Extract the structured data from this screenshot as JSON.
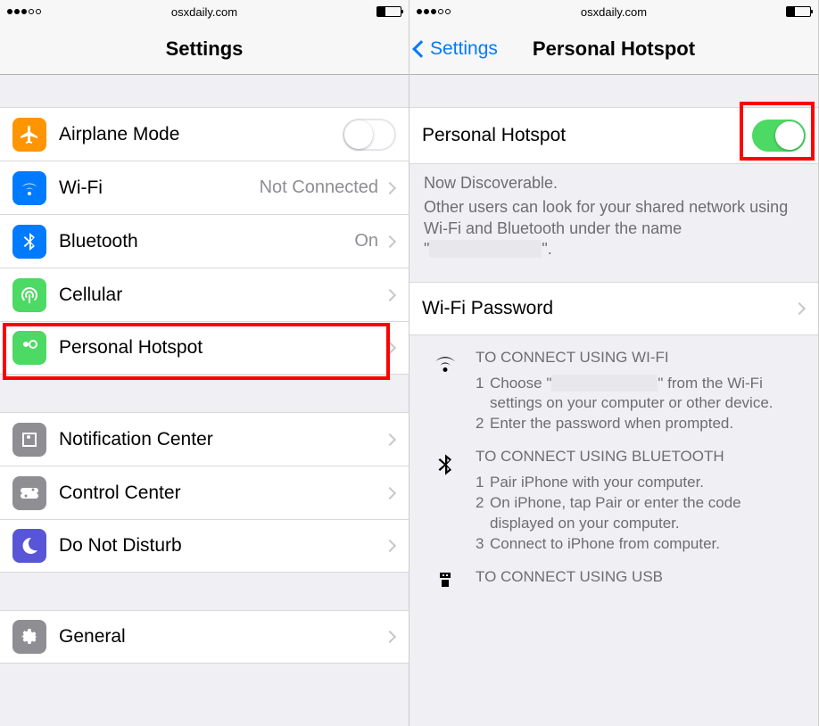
{
  "statusbar": {
    "center": "osxdaily.com"
  },
  "left": {
    "title": "Settings",
    "items": {
      "airplane": {
        "label": "Airplane Mode"
      },
      "wifi": {
        "label": "Wi-Fi",
        "value": "Not Connected"
      },
      "bluetooth": {
        "label": "Bluetooth",
        "value": "On"
      },
      "cellular": {
        "label": "Cellular"
      },
      "hotspot": {
        "label": "Personal Hotspot"
      },
      "notif": {
        "label": "Notification Center"
      },
      "control": {
        "label": "Control Center"
      },
      "dnd": {
        "label": "Do Not Disturb"
      },
      "general": {
        "label": "General"
      }
    }
  },
  "right": {
    "back": "Settings",
    "title": "Personal Hotspot",
    "toggle": {
      "label": "Personal Hotspot"
    },
    "discover": {
      "line1": "Now Discoverable.",
      "line2a": "Other users can look for your shared network using Wi-Fi and Bluetooth under the name \"",
      "line2b": "\"."
    },
    "wifipw": {
      "label": "Wi-Fi Password"
    },
    "instr_wifi": {
      "title": "TO CONNECT USING WI-FI",
      "s1a": "Choose \"",
      "s1b": "\" from the Wi-Fi settings on your computer or other device.",
      "s2": "Enter the password when prompted."
    },
    "instr_bt": {
      "title": "TO CONNECT USING BLUETOOTH",
      "s1": "Pair iPhone with your computer.",
      "s2": "On iPhone, tap Pair or enter the code displayed on your computer.",
      "s3": "Connect to iPhone from computer."
    },
    "instr_usb": {
      "title": "TO CONNECT USING USB"
    }
  }
}
